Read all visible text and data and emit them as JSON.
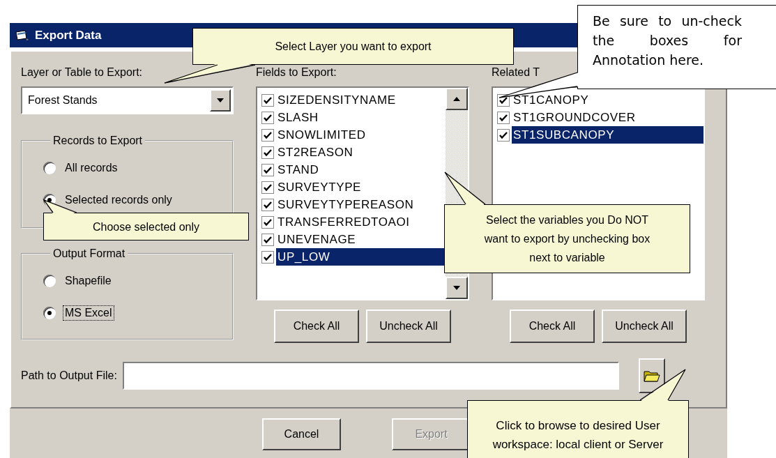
{
  "window": {
    "title": "Export Data"
  },
  "layer": {
    "label": "Layer or Table to Export:",
    "value": "Forest Stands"
  },
  "records": {
    "title": "Records to Export",
    "options": [
      {
        "label": "All records",
        "selected": false,
        "focused": false
      },
      {
        "label": "Selected records only",
        "selected": true,
        "focused": false
      }
    ]
  },
  "output_format": {
    "title": "Output Format",
    "options": [
      {
        "label": "Shapefile",
        "selected": false,
        "focused": false
      },
      {
        "label": "MS Excel",
        "selected": true,
        "focused": true
      }
    ]
  },
  "fields": {
    "label": "Fields to Export:",
    "items": [
      {
        "name": "SIZEDENSITYNAME",
        "checked": true,
        "selected": false
      },
      {
        "name": "SLASH",
        "checked": true,
        "selected": false
      },
      {
        "name": "SNOWLIMITED",
        "checked": true,
        "selected": false
      },
      {
        "name": "ST2REASON",
        "checked": true,
        "selected": false
      },
      {
        "name": "STAND",
        "checked": true,
        "selected": false
      },
      {
        "name": "SURVEYTYPE",
        "checked": true,
        "selected": false
      },
      {
        "name": "SURVEYTYPEREASON",
        "checked": true,
        "selected": false
      },
      {
        "name": "TRANSFERREDTOAOI",
        "checked": true,
        "selected": false
      },
      {
        "name": "UNEVENAGE",
        "checked": true,
        "selected": false
      },
      {
        "name": "UP_LOW",
        "checked": true,
        "selected": true
      }
    ],
    "buttons": [
      {
        "label": "Check All"
      },
      {
        "label": "Uncheck All"
      }
    ]
  },
  "related": {
    "label": "Related T",
    "items": [
      {
        "name": "ST1CANOPY",
        "checked": true,
        "selected": false
      },
      {
        "name": "ST1GROUNDCOVER",
        "checked": true,
        "selected": false
      },
      {
        "name": "ST1SUBCANOPY",
        "checked": true,
        "selected": true
      }
    ],
    "buttons": [
      {
        "label": "Check All"
      },
      {
        "label": "Uncheck All"
      }
    ]
  },
  "path": {
    "label": "Path to Output File:"
  },
  "buttons": [
    {
      "label": "Cancel",
      "disabled": false
    },
    {
      "label": "Export",
      "disabled": true
    }
  ],
  "callouts": [
    {
      "kind": "tooltip",
      "text": "Select Layer you want to export"
    },
    {
      "kind": "tooltip",
      "text": "Choose selected only"
    },
    {
      "kind": "tooltip",
      "text": "Select the variables you Do NOT want to export  by unchecking box next to variable"
    },
    {
      "kind": "note",
      "text": "Be sure to un-check the boxes for Annotation here."
    },
    {
      "kind": "tooltip",
      "text": "Click to browse to desired User workspace: local client or Server"
    }
  ]
}
